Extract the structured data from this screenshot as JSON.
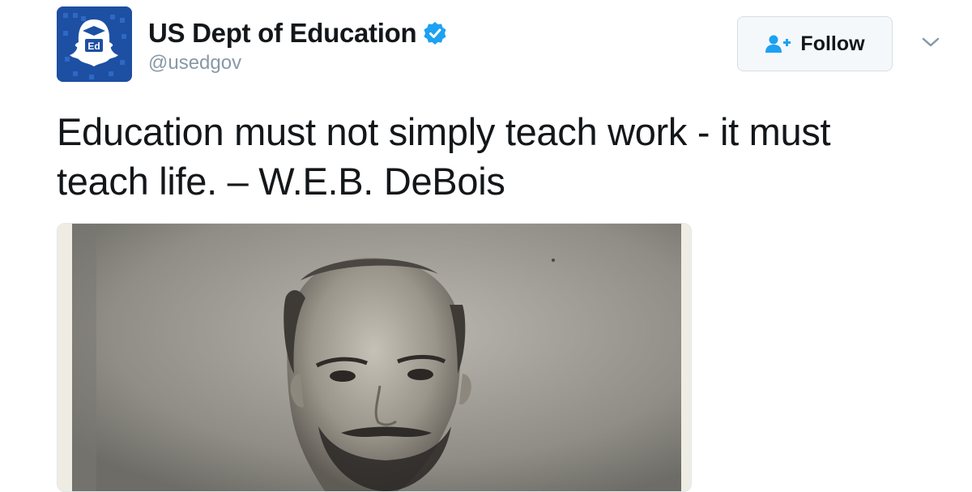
{
  "account": {
    "display_name": "US Dept of Education",
    "handle": "@usedgov",
    "verified": true,
    "avatar_icon": "snapchat-ghost-ed-icon",
    "avatar_text": "Ed"
  },
  "actions": {
    "follow_label": "Follow",
    "follow_icon": "add-user-icon",
    "menu_icon": "chevron-down-icon"
  },
  "tweet": {
    "text": "Education must not simply teach work - it must teach life. – W.E.B. DeBois"
  },
  "media": {
    "type": "photo",
    "subject": "sepia portrait photograph"
  },
  "colors": {
    "brand_blue": "#1da1f2",
    "avatar_blue": "#1d4fa3",
    "text": "#14171a",
    "muted": "#8899a6"
  }
}
